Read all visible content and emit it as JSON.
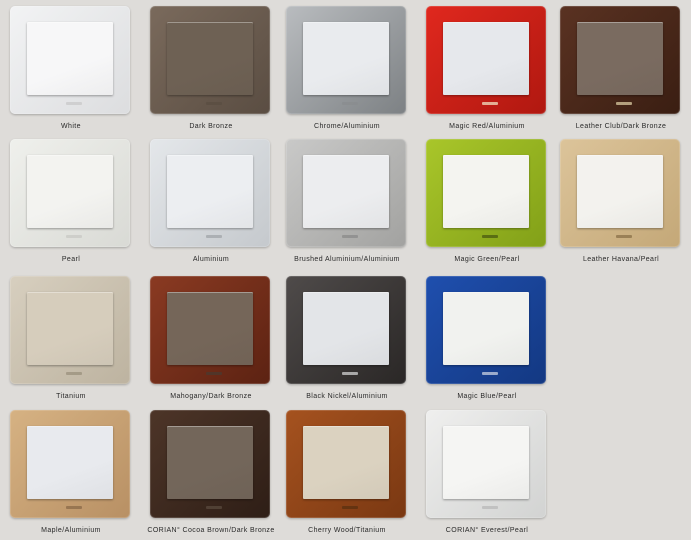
{
  "swatches": [
    {
      "label": "White",
      "frame": "#f2f3f4",
      "frame2": "#dcdddf",
      "rocker": "#f7f7f8",
      "logo": "#c8c8c8"
    },
    {
      "label": "Dark Bronze",
      "frame": "#7a6a5c",
      "frame2": "#5a4d42",
      "rocker": "#6e6154",
      "logo": "#5a4d42"
    },
    {
      "label": "Chrome/Aluminium",
      "frame": "#b9bcbf",
      "frame2": "#7d8184",
      "rocker": "#e9ebee",
      "logo": "#8a8c8f"
    },
    {
      "label": "Magic Red/Aluminium",
      "frame": "#e0281e",
      "frame2": "#b01810",
      "rocker": "#e6e8ec",
      "logo": "#f0e0c0"
    },
    {
      "label": "Leather Club/Dark Bronze",
      "frame": "#5a3222",
      "frame2": "#3a1e12",
      "rocker": "#7a6b60",
      "logo": "#d8c8a0"
    },
    {
      "label": "Pearl",
      "frame": "#eff0ec",
      "frame2": "#d9dad5",
      "rocker": "#f3f3f0",
      "logo": "#c8c8c4"
    },
    {
      "label": "Aluminium",
      "frame": "#e4e7ea",
      "frame2": "#c5c9cd",
      "rocker": "#eceef1",
      "logo": "#a0a4a8"
    },
    {
      "label": "Brushed Aluminium/Aluminium",
      "frame": "#c9c9c8",
      "frame2": "#a2a2a0",
      "rocker": "#ecedef",
      "logo": "#8a8a8a"
    },
    {
      "label": "Magic Green/Pearl",
      "frame": "#a9c62a",
      "frame2": "#82a018",
      "rocker": "#f4f4f0",
      "logo": "#4a5a10"
    },
    {
      "label": "Leather Havana/Pearl",
      "frame": "#dcc49a",
      "frame2": "#c4a878",
      "rocker": "#f3f2ee",
      "logo": "#8a7048"
    },
    {
      "label": "Titanium",
      "frame": "#d7cfbf",
      "frame2": "#bdb3a0",
      "rocker": "#d6cdbc",
      "logo": "#9a907c"
    },
    {
      "label": "Mahogany/Dark Bronze",
      "frame": "#8a3a22",
      "frame2": "#5c2212",
      "rocker": "#756659",
      "logo": "#4a3a30"
    },
    {
      "label": "Black Nickel/Aluminium",
      "frame": "#4f4b4a",
      "frame2": "#2a2726",
      "rocker": "#e3e5e8",
      "logo": "#d0d0d0"
    },
    {
      "label": "Magic Blue/Pearl",
      "frame": "#1f4fae",
      "frame2": "#133882",
      "rocker": "#f1f2ef",
      "logo": "#c8d0e0"
    },
    {
      "label": "Maple/Aluminium",
      "frame": "#d6b283",
      "frame2": "#b89064",
      "rocker": "#e8eaee",
      "logo": "#8a6a48"
    },
    {
      "label": "CORIAN° Cocoa Brown/Dark Bronze",
      "frame": "#4d3528",
      "frame2": "#2e1e16",
      "rocker": "#73665a",
      "logo": "#5a4a3e"
    },
    {
      "label": "Cherry Wood/Titanium",
      "frame": "#a5521f",
      "frame2": "#7a3812",
      "rocker": "#dbd2c0",
      "logo": "#5a3010"
    },
    {
      "label": "CORIAN° Everest/Pearl",
      "frame": "#efefee",
      "frame2": "#d2d3d2",
      "rocker": "#f5f5f3",
      "logo": "#b8b8b8"
    }
  ]
}
